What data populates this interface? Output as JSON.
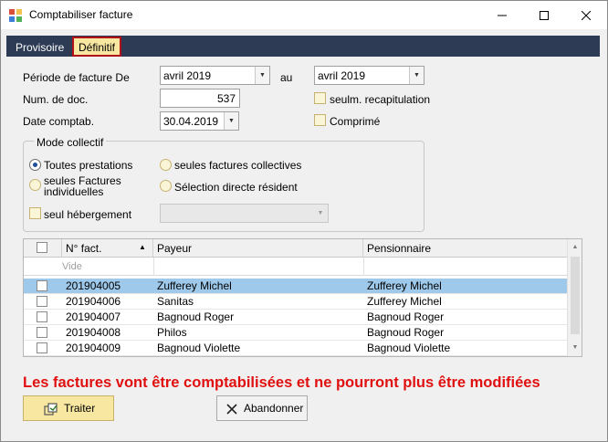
{
  "window": {
    "title": "Comptabiliser facture"
  },
  "tabs": [
    {
      "label": "Provisoire",
      "active": false
    },
    {
      "label": "Définitif",
      "active": true
    }
  ],
  "form": {
    "periode_label": "Période de facture De",
    "periode_from": "avril 2019",
    "au_label": "au",
    "periode_to": "avril 2019",
    "num_doc_label": "Num. de doc.",
    "num_doc_value": "537",
    "date_label": "Date comptab.",
    "date_value": "30.04.2019",
    "recap_label": "seulm. recapitulation",
    "recap_checked": false,
    "comprime_label": "Comprimé",
    "comprime_checked": false
  },
  "mode_collectif": {
    "title": "Mode collectif",
    "options": [
      {
        "label": "Toutes prestations",
        "selected": true
      },
      {
        "label": "seules Factures individuelles",
        "selected": false
      },
      {
        "label": "seules factures collectives",
        "selected": false
      },
      {
        "label": "Sélection directe résident",
        "selected": false
      }
    ],
    "hebergement_label": "seul hébergement",
    "hebergement_checked": false,
    "hebergement_combo": ""
  },
  "grid": {
    "columns": [
      "N° fact.",
      "Payeur",
      "Pensionnaire"
    ],
    "filter_placeholder": "Vide",
    "rows": [
      {
        "num": "201904005",
        "payeur": "Zufferey Michel",
        "pensionnaire": "Zufferey Michel",
        "selected": true
      },
      {
        "num": "201904006",
        "payeur": "Sanitas",
        "pensionnaire": "Zufferey Michel",
        "selected": false
      },
      {
        "num": "201904007",
        "payeur": "Bagnoud Roger",
        "pensionnaire": "Bagnoud Roger",
        "selected": false
      },
      {
        "num": "201904008",
        "payeur": "Philos",
        "pensionnaire": "Bagnoud Roger",
        "selected": false
      },
      {
        "num": "201904009",
        "payeur": "Bagnoud Violette",
        "pensionnaire": "Bagnoud Violette",
        "selected": false
      }
    ]
  },
  "warning": "Les factures vont être comptabilisées et ne pourront plus être modifiées",
  "buttons": {
    "traiter": "Traiter",
    "abandonner": "Abandonner"
  },
  "colors": {
    "accent_tab": "#f7e7a0",
    "tab_strip": "#2d3b55",
    "selection": "#9ec9ea",
    "warning": "#e01010"
  }
}
